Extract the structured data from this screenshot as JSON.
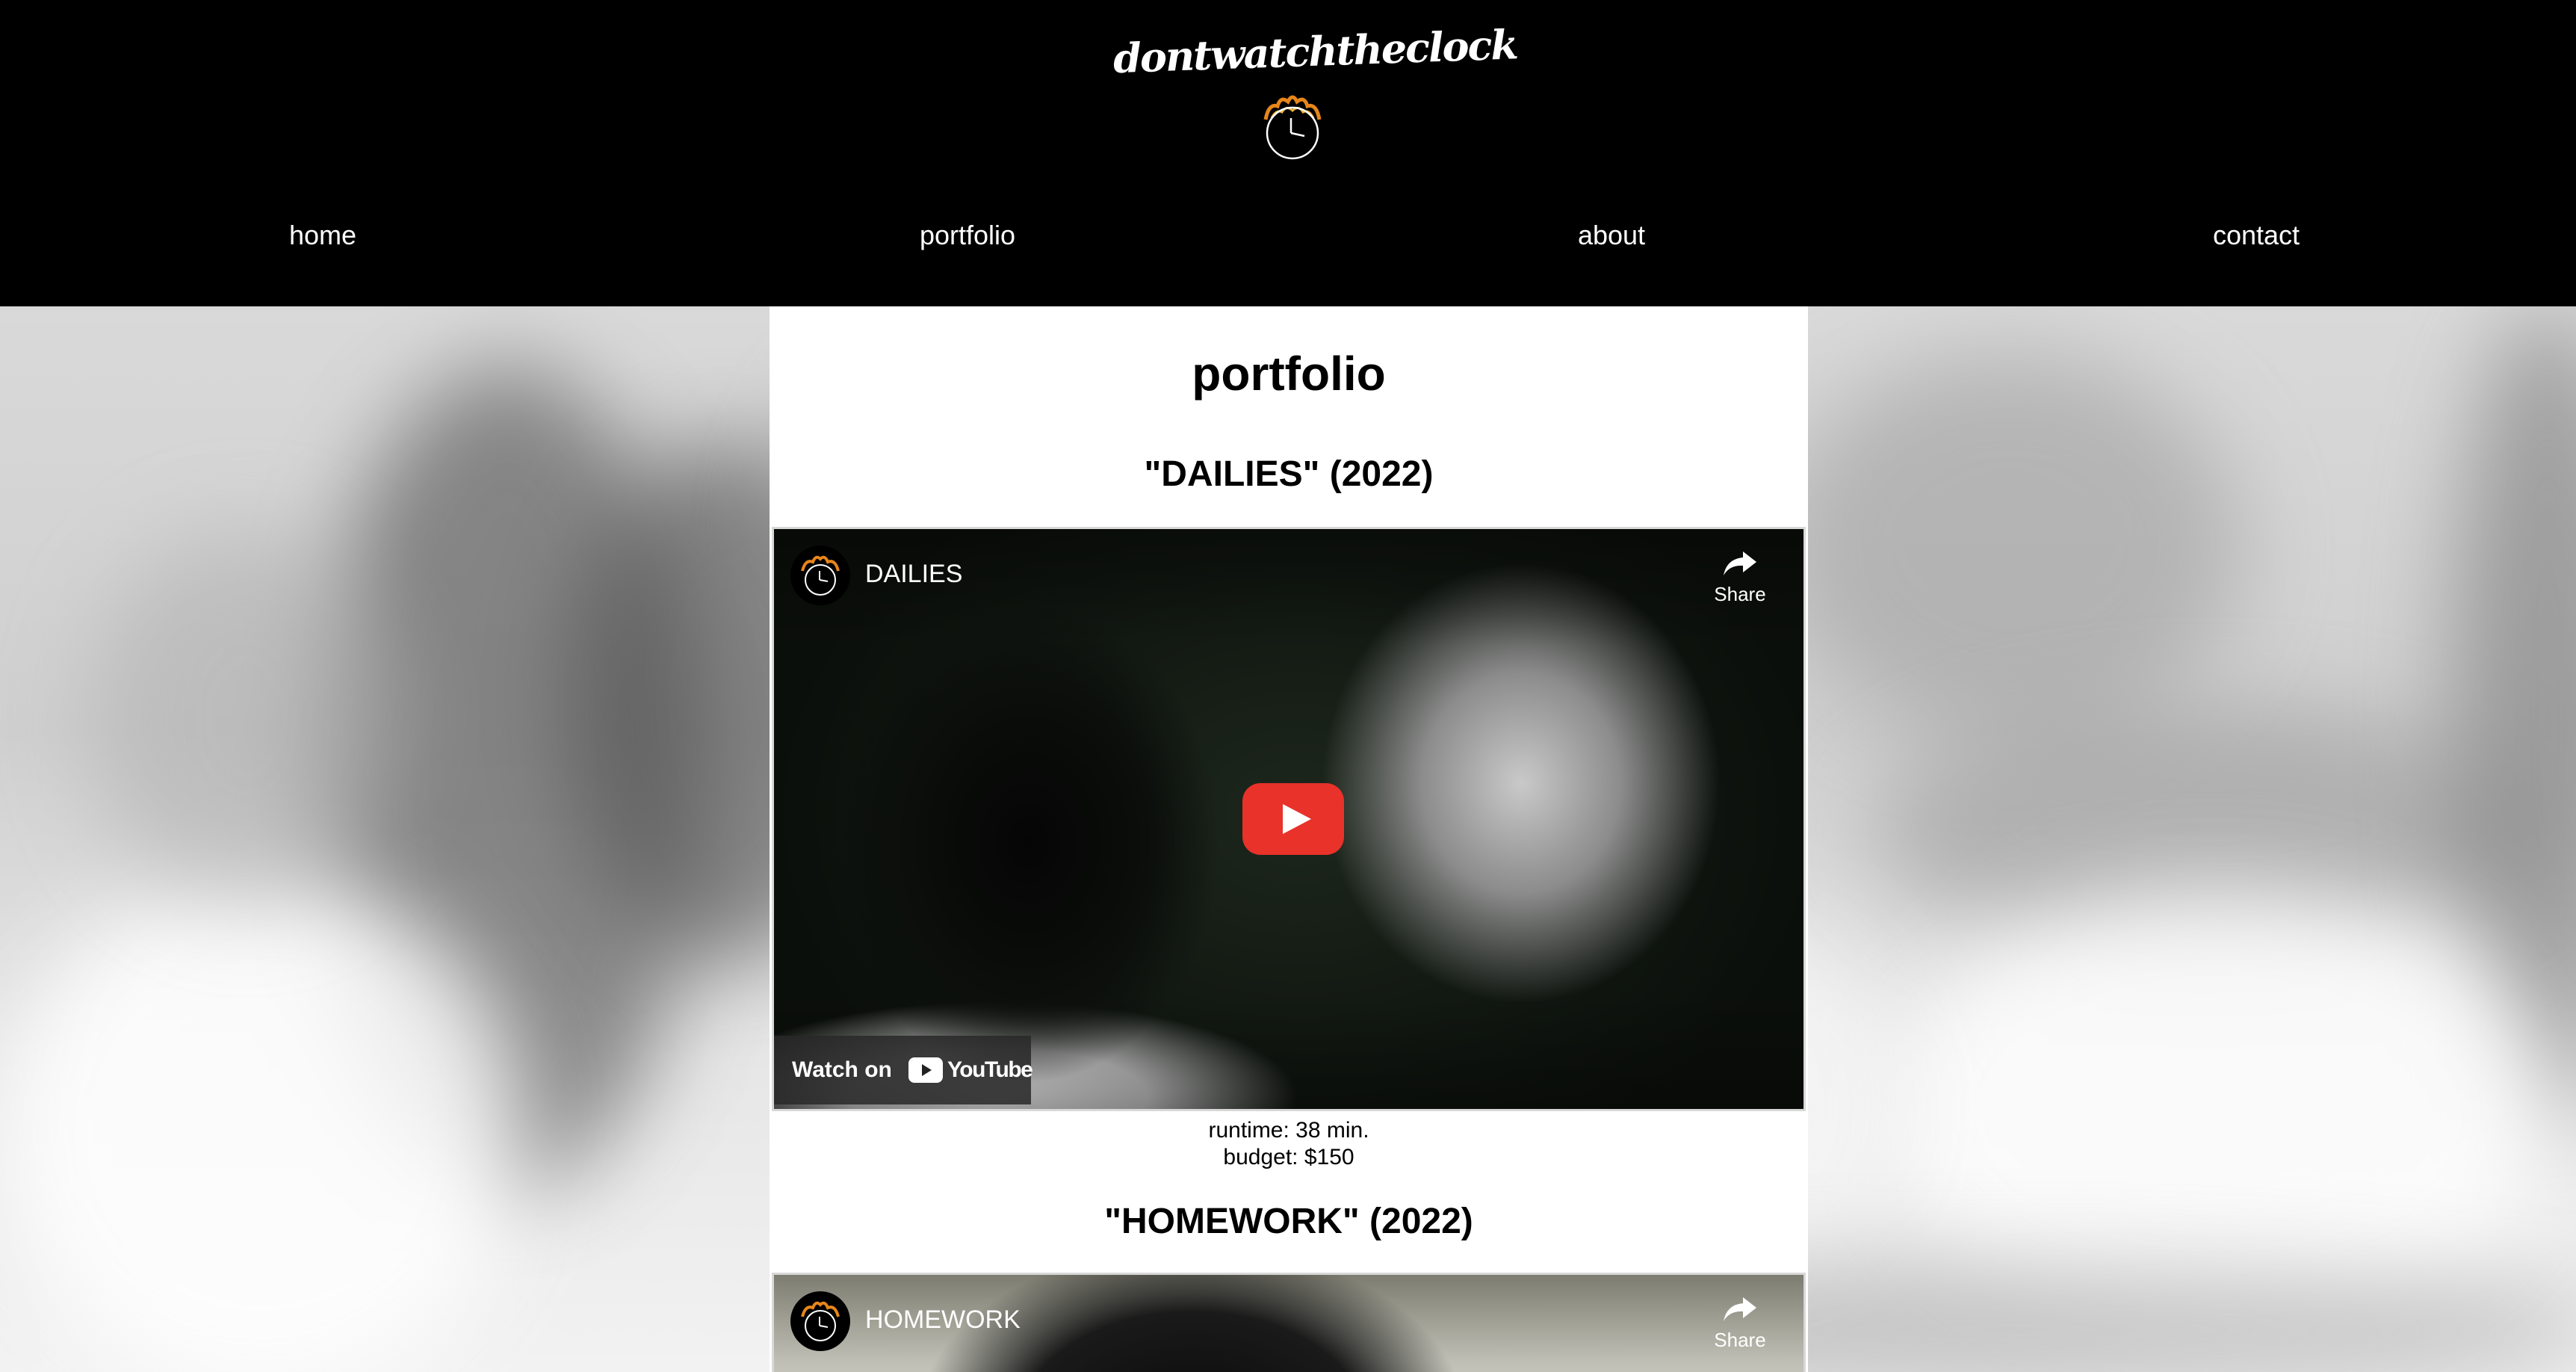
{
  "header": {
    "brand": "dontwatchtheclock",
    "logo_icon": "flaming-clock-icon"
  },
  "nav": {
    "items": [
      {
        "label": "home"
      },
      {
        "label": "portfolio"
      },
      {
        "label": "about"
      },
      {
        "label": "contact"
      }
    ]
  },
  "page": {
    "title": "portfolio"
  },
  "films": [
    {
      "title": "\"DAILIES\" (2022)",
      "video_title": "DAILIES",
      "share_label": "Share",
      "watch_label": "Watch on",
      "youtube_label": "YouTube",
      "runtime": "runtime: 38 min.",
      "budget": "budget: $150"
    },
    {
      "title": "\"HOMEWORK\" (2022)",
      "video_title": "HOMEWORK",
      "share_label": "Share"
    }
  ],
  "colors": {
    "header_bg": "#000000",
    "youtube_red": "#e8322a",
    "logo_flame": "#e8861a"
  }
}
